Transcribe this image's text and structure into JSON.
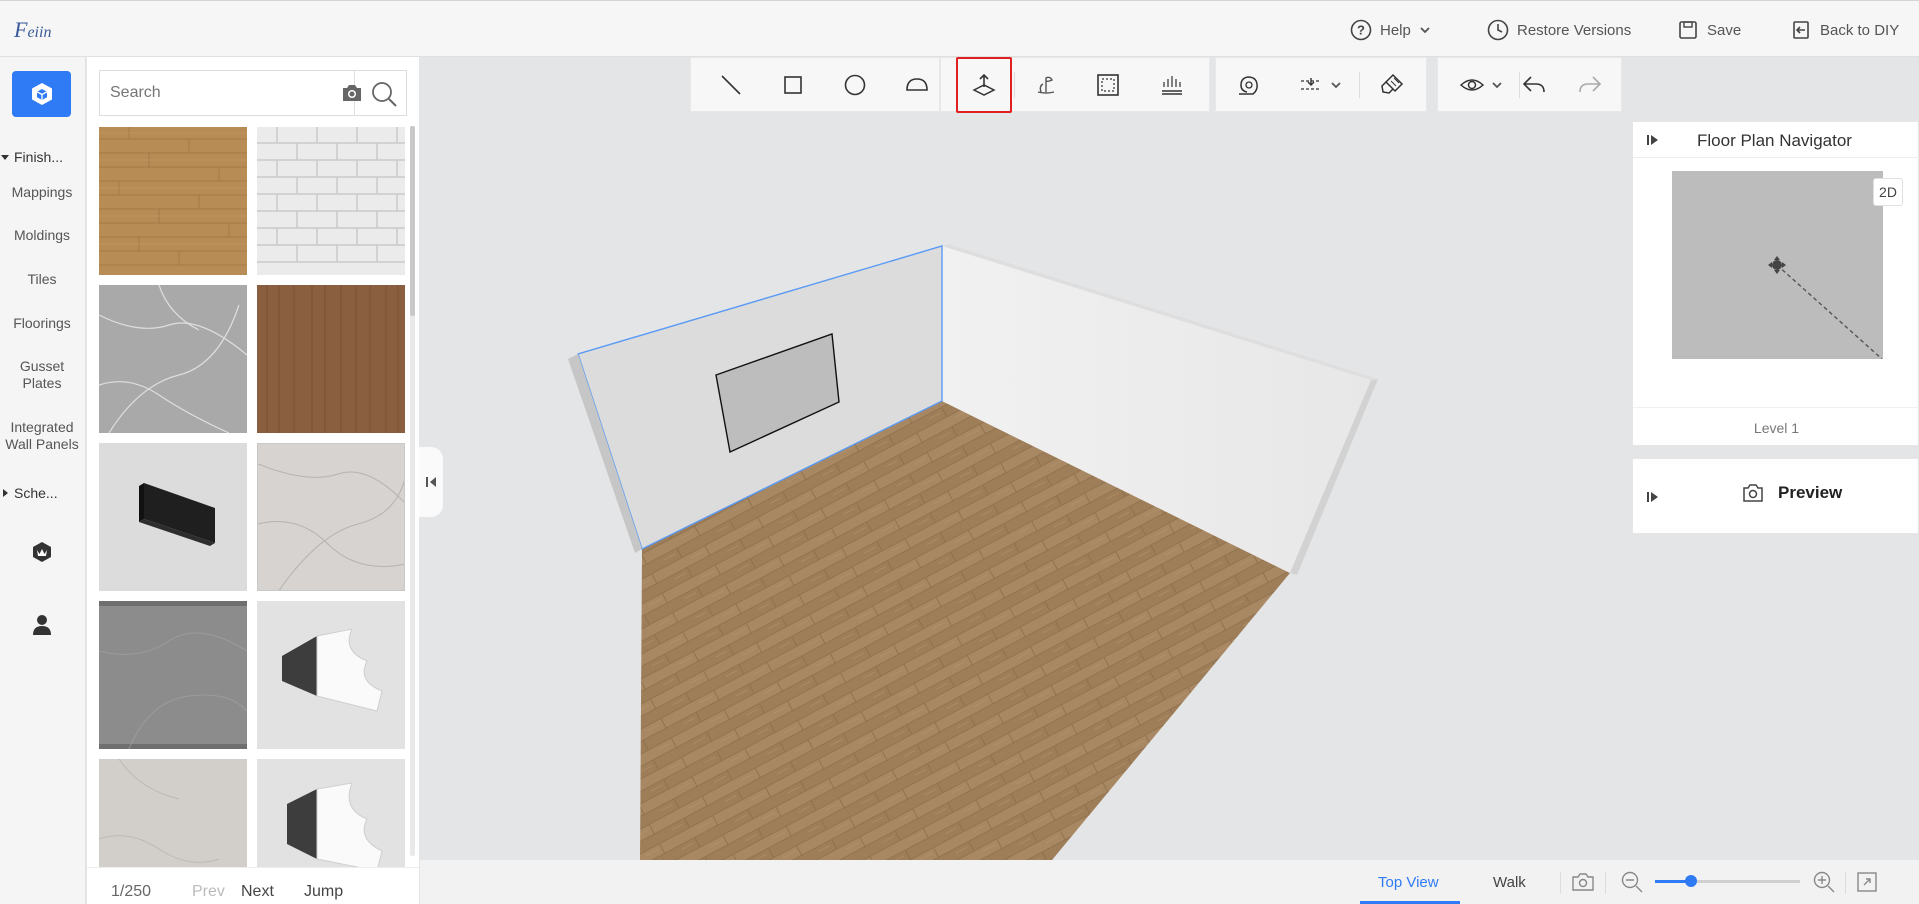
{
  "app": {
    "logo_initial": "F",
    "logo_rest": "eiin"
  },
  "header": {
    "help": "Help",
    "restore": "Restore Versions",
    "save": "Save",
    "back": "Back to DIY"
  },
  "rail": {
    "section_finishes": "Finish...",
    "items": [
      "Mappings",
      "Moldings",
      "Tiles",
      "Floorings",
      "Gusset Plates",
      "Integrated Wall Panels"
    ],
    "section_schemes": "Sche..."
  },
  "materials": {
    "search_placeholder": "Search",
    "tiles": [
      "oak-wood-floor",
      "white-brick",
      "grey-marble",
      "walnut-wood",
      "black-wall-panel",
      "light-grey-marble",
      "dark-grey-stone",
      "crown-molding-1",
      "cream-stone",
      "crown-molding-2"
    ],
    "pager": {
      "page": "1/250",
      "prev": "Prev",
      "next": "Next",
      "jump": "Jump"
    }
  },
  "toolbar": {
    "groups": [
      [
        "line-icon",
        "rectangle-icon",
        "circle-icon",
        "arc-icon"
      ],
      [
        "extrude-icon",
        "pole-icon",
        "area-select-icon",
        "level-icon"
      ],
      [
        "measure-icon",
        "align-icon",
        "brush-icon"
      ],
      [
        "eye-icon",
        "undo-icon",
        "redo-icon"
      ]
    ],
    "active_tool": "extrude-icon"
  },
  "navigator": {
    "title": "Floor Plan Navigator",
    "mode": "2D",
    "level": "Level 1"
  },
  "preview": {
    "label": "Preview"
  },
  "bottom": {
    "top_view": "Top View",
    "walk": "Walk",
    "zoom_fraction": 0.25
  },
  "colors": {
    "accent": "#2f7bf5",
    "active_tool_border": "#e02020",
    "wall_selection": "#5a9af5"
  }
}
